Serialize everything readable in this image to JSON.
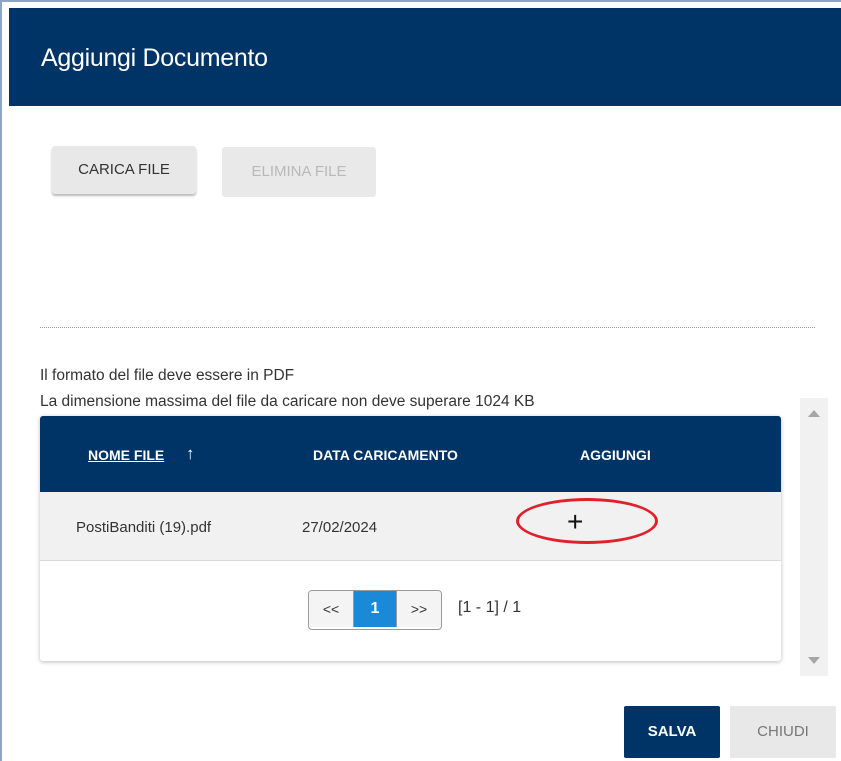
{
  "dialog": {
    "title": "Aggiungi Documento"
  },
  "toolbar": {
    "upload_label": "CARICA FILE",
    "delete_label": "ELIMINA FILE"
  },
  "notes": {
    "format": "Il formato del file deve essere in PDF",
    "max_size": "La dimensione massima del file da caricare non deve superare 1024 KB"
  },
  "table": {
    "columns": {
      "name": "NOME FILE",
      "sort_arrow": "↑",
      "date": "DATA CARICAMENTO",
      "add": "AGGIUNGI"
    },
    "rows": [
      {
        "name": "PostiBanditi (19).pdf",
        "date": "27/02/2024",
        "add": "+"
      }
    ]
  },
  "pagination": {
    "prev": "<<",
    "current": "1",
    "next": ">>",
    "info": "[1 - 1] / 1"
  },
  "footer": {
    "save_label": "SALVA",
    "close_label": "CHIUDI"
  },
  "colors": {
    "header": "#003366",
    "active_page": "#1a8ad8",
    "highlight": "#e0202a"
  }
}
